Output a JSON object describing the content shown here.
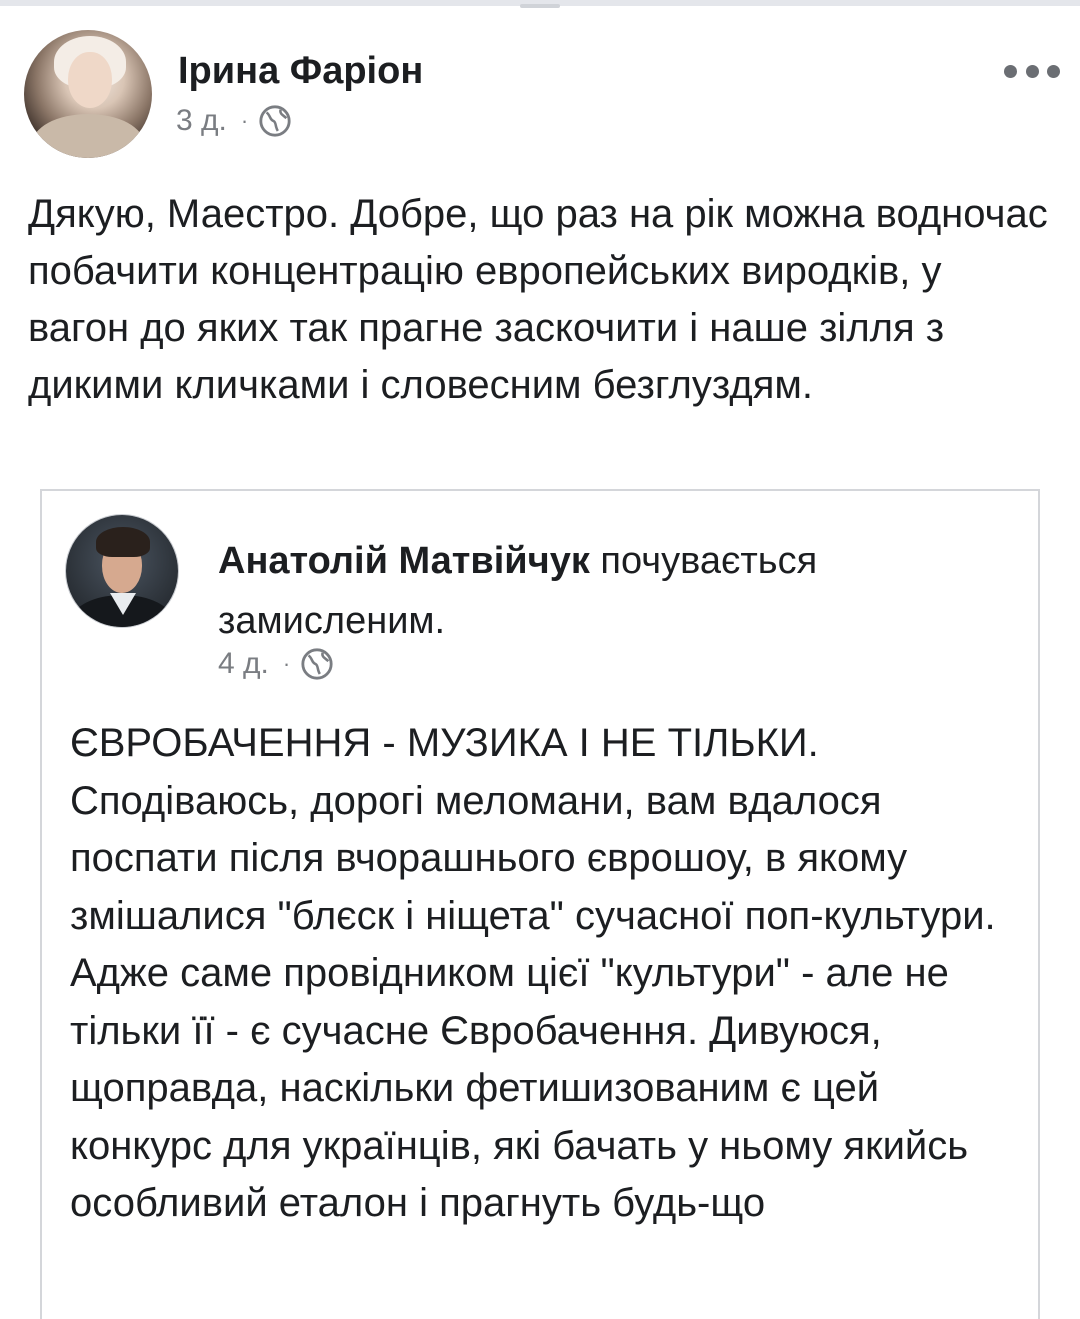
{
  "post": {
    "author": "Ірина Фаріон",
    "time": "3 д.",
    "separator": "·",
    "privacy_icon": "globe-icon",
    "more_icon": "more-options-icon",
    "text": "Дякую, Маестро. Добре, що раз на рік можна водночас побачити концентрацію европейських виродків, у вагон до яких так прагне заскочити і наше зілля з дикими кличками і словесним безглуздям."
  },
  "shared_post": {
    "author": "Анатолій Матвійчук",
    "activity": " почувається замисленим.",
    "time": "4 д.",
    "separator": "·",
    "privacy_icon": "globe-icon",
    "heading": "ЄВРОБАЧЕННЯ - МУЗИКА І НЕ ТІЛЬКИ.",
    "body": "Сподіваюсь, дорогі меломани, вам вдалося поспати після вчорашнього єврошоу, в якому змішалися \"блєск і ніщета\" сучасної поп-культури. Адже саме провідником цієї \"культури\" - але не тільки її - є сучасне Євробачення. Дивуюся, щоправда, наскільки фетишизованим є цей конкурс для українців, які бачать у ньому якийсь особливий еталон і прагнуть будь-що"
  },
  "colors": {
    "text": "#1c1e21",
    "meta": "#7a7d82",
    "card_border": "#d4d6da"
  }
}
